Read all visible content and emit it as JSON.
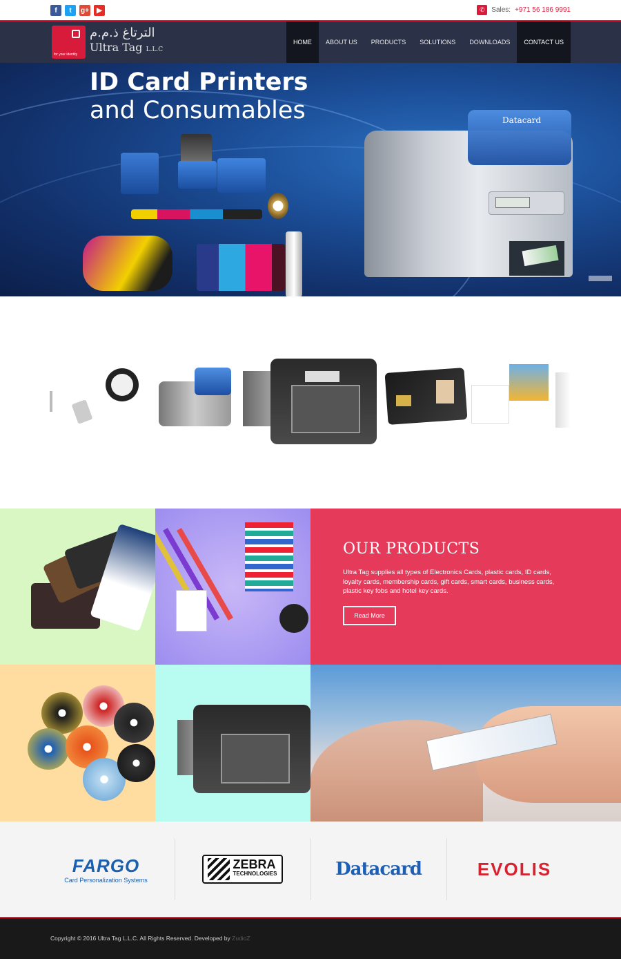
{
  "topbar": {
    "social": [
      {
        "icon": "facebook-icon",
        "glyph": "f"
      },
      {
        "icon": "twitter-icon",
        "glyph": "t"
      },
      {
        "icon": "google-plus-icon",
        "glyph": "g+"
      },
      {
        "icon": "youtube-icon",
        "glyph": "▶"
      }
    ],
    "sales_label": "Sales:",
    "sales_number": "+971 56 186 9991",
    "phone_icon": "phone-icon"
  },
  "header": {
    "logo_arabic": "الترتاغ ذ.م.م",
    "logo_name": "Ultra Tag",
    "logo_suffix": "L.L.C",
    "logo_tagline": "for your identity",
    "nav": [
      {
        "label": "HOME",
        "active": true
      },
      {
        "label": "ABOUT US",
        "active": false
      },
      {
        "label": "PRODUCTS",
        "active": false
      },
      {
        "label": "SOLUTIONS",
        "active": false
      },
      {
        "label": "DOWNLOADS",
        "active": false
      },
      {
        "label": "CONTACT US",
        "active": true
      }
    ]
  },
  "hero": {
    "title_line1": "ID Card Printers",
    "title_line2": "and Consumables",
    "printer_brand": "Datacard"
  },
  "promo": {
    "heading": "OUR PRODUCTS",
    "text": "Ultra Tag supplies all types of Electronics Cards, plastic cards, ID cards, loyalty cards, membership cards, gift cards, smart cards, business cards, plastic key fobs and hotel key cards.",
    "button": "Read More"
  },
  "brands": {
    "fargo": "FARGO",
    "fargo_sub": "Card Personalization Systems",
    "zebra": "ZEBRA",
    "zebra_sub": "TECHNOLOGIES",
    "datacard": "Datacard",
    "evolis": "EVOLIS"
  },
  "footer": {
    "copyright": "Copyright © 2016 Ultra Tag L.L.C. All Rights Reserved. Developed by",
    "developer": "ZudioZ"
  },
  "colors": {
    "accent": "#d81b3b",
    "header_bg": "#2b3247",
    "promo_bg": "#e53a5a",
    "footer_bg": "#191919"
  }
}
